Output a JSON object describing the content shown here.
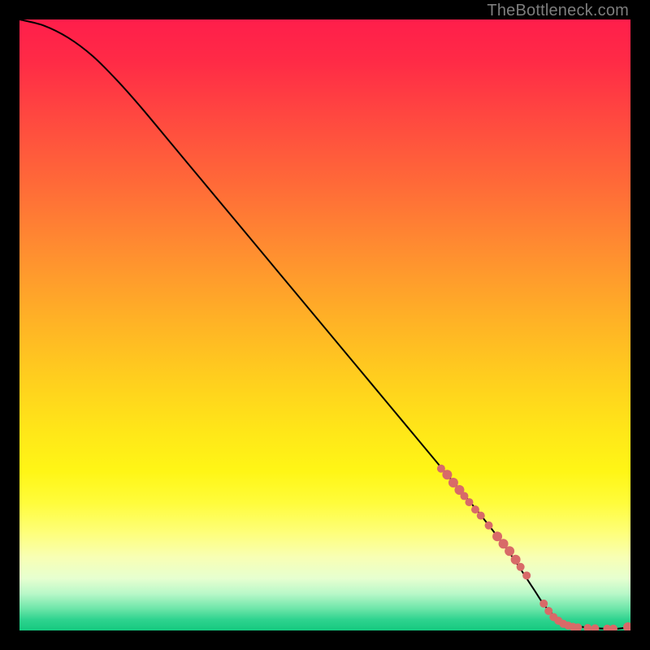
{
  "watermark": {
    "text": "TheBottleneck.com"
  },
  "colors": {
    "curve": "#000000",
    "marker_fill": "#d86a68",
    "marker_stroke": "#d86a68"
  },
  "chart_data": {
    "type": "line",
    "title": "",
    "xlabel": "",
    "ylabel": "",
    "xlim": [
      0,
      100
    ],
    "ylim": [
      0,
      100
    ],
    "grid": false,
    "series": [
      {
        "name": "curve",
        "x": [
          0,
          4,
          8,
          12,
          16,
          20,
          25,
          30,
          35,
          40,
          45,
          50,
          55,
          60,
          65,
          70,
          75,
          80,
          84,
          86,
          88,
          90,
          92,
          94,
          96,
          98,
          100
        ],
        "y": [
          100,
          99,
          97,
          94,
          90,
          85.5,
          79.5,
          73.5,
          67.5,
          61.5,
          55.5,
          49.5,
          43.5,
          37.5,
          31.5,
          25.5,
          19.5,
          13,
          7,
          4,
          2,
          1,
          0.6,
          0.4,
          0.3,
          0.3,
          0.6
        ]
      }
    ],
    "markers": [
      {
        "x": 69.0,
        "y": 26.5,
        "r": 5
      },
      {
        "x": 70.0,
        "y": 25.5,
        "r": 6
      },
      {
        "x": 71.0,
        "y": 24.2,
        "r": 6
      },
      {
        "x": 72.0,
        "y": 23.0,
        "r": 6
      },
      {
        "x": 72.8,
        "y": 22.0,
        "r": 5
      },
      {
        "x": 73.6,
        "y": 21.0,
        "r": 5
      },
      {
        "x": 74.6,
        "y": 19.8,
        "r": 5
      },
      {
        "x": 75.5,
        "y": 18.8,
        "r": 5
      },
      {
        "x": 76.8,
        "y": 17.2,
        "r": 5
      },
      {
        "x": 78.2,
        "y": 15.4,
        "r": 6
      },
      {
        "x": 79.2,
        "y": 14.2,
        "r": 6
      },
      {
        "x": 80.2,
        "y": 13.0,
        "r": 6
      },
      {
        "x": 81.2,
        "y": 11.6,
        "r": 6
      },
      {
        "x": 82.0,
        "y": 10.4,
        "r": 5
      },
      {
        "x": 83.0,
        "y": 9.0,
        "r": 5
      },
      {
        "x": 85.8,
        "y": 4.4,
        "r": 5
      },
      {
        "x": 86.6,
        "y": 3.2,
        "r": 5
      },
      {
        "x": 87.4,
        "y": 2.2,
        "r": 5
      },
      {
        "x": 88.2,
        "y": 1.6,
        "r": 5
      },
      {
        "x": 89.0,
        "y": 1.1,
        "r": 5
      },
      {
        "x": 89.8,
        "y": 0.8,
        "r": 5
      },
      {
        "x": 90.6,
        "y": 0.6,
        "r": 5
      },
      {
        "x": 91.4,
        "y": 0.5,
        "r": 5
      },
      {
        "x": 93.0,
        "y": 0.4,
        "r": 5
      },
      {
        "x": 94.2,
        "y": 0.35,
        "r": 5
      },
      {
        "x": 96.2,
        "y": 0.3,
        "r": 5
      },
      {
        "x": 97.2,
        "y": 0.3,
        "r": 5
      },
      {
        "x": 99.6,
        "y": 0.55,
        "r": 6
      }
    ]
  }
}
